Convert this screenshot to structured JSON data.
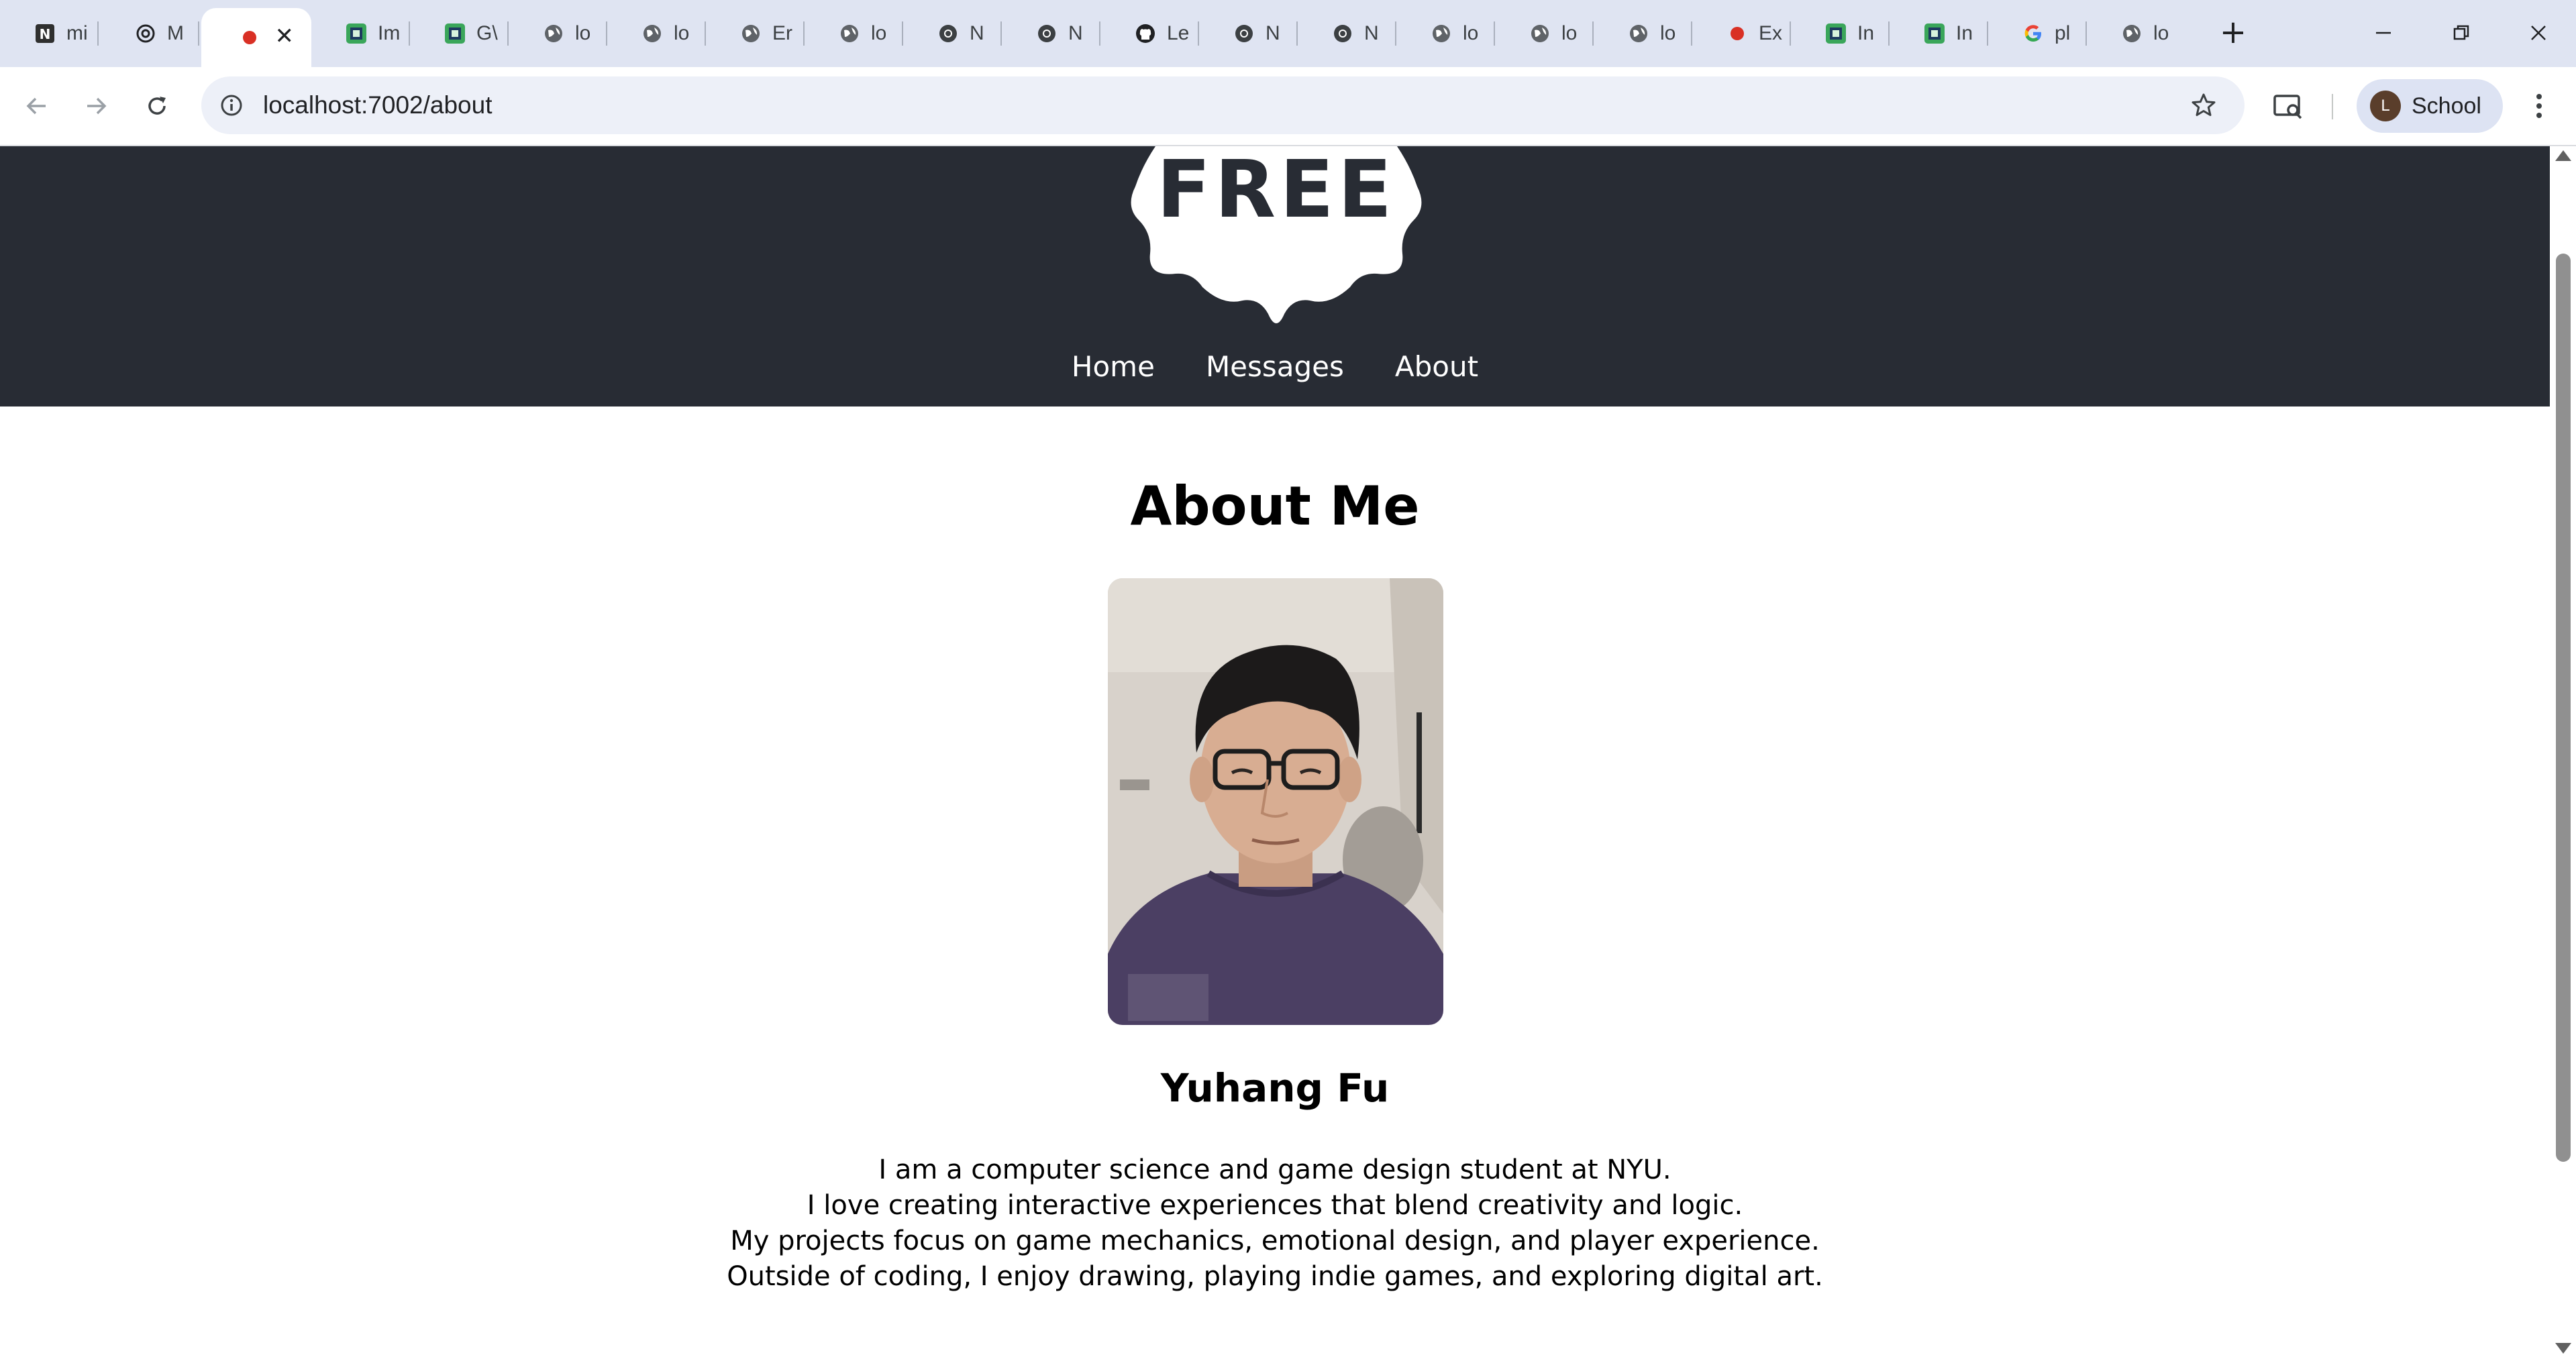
{
  "browser": {
    "tabs": [
      {
        "title": "mi",
        "icon": "notion-icon"
      },
      {
        "title": "M",
        "icon": "openai-icon"
      },
      {
        "title": "",
        "icon": "recording-dot-icon",
        "active": true
      },
      {
        "title": "Im",
        "icon": "pixel-art-icon"
      },
      {
        "title": "G\\",
        "icon": "pixel-art-icon"
      },
      {
        "title": "lo",
        "icon": "globe-icon"
      },
      {
        "title": "lo",
        "icon": "globe-icon"
      },
      {
        "title": "Er",
        "icon": "globe-icon"
      },
      {
        "title": "lo",
        "icon": "globe-icon"
      },
      {
        "title": "N",
        "icon": "chrome-icon"
      },
      {
        "title": "N",
        "icon": "chrome-icon"
      },
      {
        "title": "Le",
        "icon": "github-icon"
      },
      {
        "title": "N",
        "icon": "chrome-icon"
      },
      {
        "title": "N",
        "icon": "chrome-icon"
      },
      {
        "title": "lo",
        "icon": "globe-icon"
      },
      {
        "title": "lo",
        "icon": "globe-icon"
      },
      {
        "title": "lo",
        "icon": "globe-icon"
      },
      {
        "title": "Ex",
        "icon": "recording-dot-icon"
      },
      {
        "title": "In",
        "icon": "pixel-art-icon"
      },
      {
        "title": "In",
        "icon": "pixel-art-icon"
      },
      {
        "title": "pl",
        "icon": "google-icon"
      },
      {
        "title": "lo",
        "icon": "globe-icon"
      }
    ],
    "url": "localhost:7002/about",
    "profile": {
      "initial": "L",
      "name": "School"
    }
  },
  "site": {
    "logo_text": "FREE",
    "nav": {
      "home": "Home",
      "messages": "Messages",
      "about": "About"
    }
  },
  "about": {
    "title": "About Me",
    "name": "Yuhang Fu",
    "bio": [
      "I am a computer science and game design student at NYU.",
      "I love creating interactive experiences that blend creativity and logic.",
      "My projects focus on game mechanics, emotional design, and player experience.",
      "Outside of coding, I enjoy drawing, playing indie games, and exploring digital art."
    ]
  },
  "colors": {
    "header_bg": "#282c34",
    "tabstrip_bg": "#dfe4f2",
    "omnibox_bg": "#edf0f8",
    "recording_red": "#d93025"
  }
}
